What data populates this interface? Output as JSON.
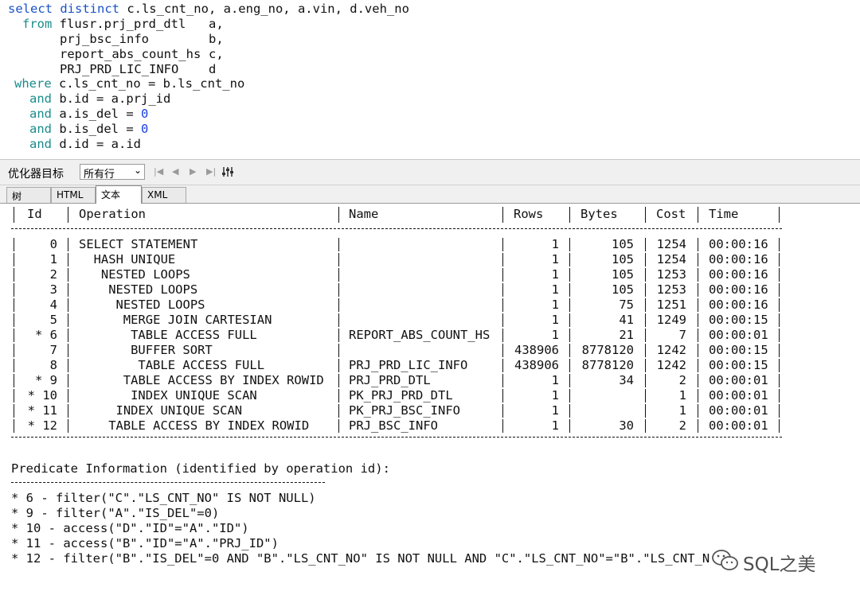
{
  "sql": {
    "line1": {
      "kw1": "select distinct",
      "rest": " c.ls_cnt_no, a.eng_no, a.vin, d.veh_no"
    },
    "line2": {
      "kw": "from",
      "table": "flusr.prj_prd_dtl",
      "alias": "a,"
    },
    "line3": {
      "table": "prj_bsc_info",
      "alias": "b,"
    },
    "line4": {
      "table": "report_abs_count_hs",
      "alias": "c,"
    },
    "line5": {
      "table": "PRJ_PRD_LIC_INFO",
      "alias": "d"
    },
    "line6": {
      "kw": "where",
      "rest": " c.ls_cnt_no = b.ls_cnt_no"
    },
    "line7": {
      "kw": "and",
      "rest": " b.id = a.prj_id"
    },
    "line8": {
      "kw": "and",
      "rest": " a.is_del = ",
      "num": "0"
    },
    "line9": {
      "kw": "and",
      "rest": " b.is_del = ",
      "num": "0"
    },
    "line10": {
      "kw": "and",
      "rest": " d.id = a.id"
    }
  },
  "toolbar": {
    "optimizer_label": "优化器目标",
    "optimizer_value": "所有行",
    "nav_first": "|◀",
    "nav_prev": "◀",
    "nav_next": "▶",
    "nav_last": "▶|",
    "settings_icon": "settings-icon"
  },
  "tabs": [
    "树",
    "HTML",
    "文本",
    "XML"
  ],
  "plan": {
    "headers": {
      "id": "Id",
      "operation": "Operation",
      "name": "Name",
      "rows": "Rows",
      "bytes": "Bytes",
      "cost": "Cost",
      "time": "Time"
    },
    "rows": [
      {
        "id": "0",
        "operation": "SELECT STATEMENT",
        "indent": 0,
        "name": "",
        "rows": "1",
        "bytes": "105",
        "cost": "1254",
        "time": "00:00:16"
      },
      {
        "id": "1",
        "operation": "HASH UNIQUE",
        "indent": 2,
        "name": "",
        "rows": "1",
        "bytes": "105",
        "cost": "1254",
        "time": "00:00:16"
      },
      {
        "id": "2",
        "operation": "NESTED LOOPS",
        "indent": 3,
        "name": "",
        "rows": "1",
        "bytes": "105",
        "cost": "1253",
        "time": "00:00:16"
      },
      {
        "id": "3",
        "operation": "NESTED LOOPS",
        "indent": 4,
        "name": "",
        "rows": "1",
        "bytes": "105",
        "cost": "1253",
        "time": "00:00:16"
      },
      {
        "id": "4",
        "operation": "NESTED LOOPS",
        "indent": 5,
        "name": "",
        "rows": "1",
        "bytes": "75",
        "cost": "1251",
        "time": "00:00:16"
      },
      {
        "id": "5",
        "operation": "MERGE JOIN CARTESIAN",
        "indent": 6,
        "name": "",
        "rows": "1",
        "bytes": "41",
        "cost": "1249",
        "time": "00:00:15"
      },
      {
        "id": "* 6",
        "operation": "TABLE ACCESS FULL",
        "indent": 7,
        "name": "REPORT_ABS_COUNT_HS",
        "rows": "1",
        "bytes": "21",
        "cost": "7",
        "time": "00:00:01"
      },
      {
        "id": "7",
        "operation": "BUFFER SORT",
        "indent": 7,
        "name": "",
        "rows": "438906",
        "bytes": "8778120",
        "cost": "1242",
        "time": "00:00:15"
      },
      {
        "id": "8",
        "operation": "TABLE ACCESS FULL",
        "indent": 8,
        "name": "PRJ_PRD_LIC_INFO",
        "rows": "438906",
        "bytes": "8778120",
        "cost": "1242",
        "time": "00:00:15"
      },
      {
        "id": "* 9",
        "operation": "TABLE ACCESS BY INDEX ROWID",
        "indent": 6,
        "name": "PRJ_PRD_DTL",
        "rows": "1",
        "bytes": "34",
        "cost": "2",
        "time": "00:00:01"
      },
      {
        "id": "* 10",
        "operation": "INDEX UNIQUE SCAN",
        "indent": 7,
        "name": "PK_PRJ_PRD_DTL",
        "rows": "1",
        "bytes": "",
        "cost": "1",
        "time": "00:00:01"
      },
      {
        "id": "* 11",
        "operation": "INDEX UNIQUE SCAN",
        "indent": 5,
        "name": "PK_PRJ_BSC_INFO",
        "rows": "1",
        "bytes": "",
        "cost": "1",
        "time": "00:00:01"
      },
      {
        "id": "* 12",
        "operation": "TABLE ACCESS BY INDEX ROWID",
        "indent": 4,
        "name": "PRJ_BSC_INFO",
        "rows": "1",
        "bytes": "30",
        "cost": "2",
        "time": "00:00:01"
      }
    ]
  },
  "predicates": {
    "title": "Predicate Information (identified by operation id):",
    "lines": [
      "* 6 - filter(\"C\".\"LS_CNT_NO\" IS NOT NULL)",
      "* 9 - filter(\"A\".\"IS_DEL\"=0)",
      "* 10 - access(\"D\".\"ID\"=\"A\".\"ID\")",
      "* 11 - access(\"B\".\"ID\"=\"A\".\"PRJ_ID\")",
      "* 12 - filter(\"B\".\"IS_DEL\"=0 AND \"B\".\"LS_CNT_NO\" IS NOT NULL AND \"C\".\"LS_CNT_NO\"=\"B\".\"LS_CNT_N"
    ]
  },
  "watermark": {
    "text": "SQL之美"
  }
}
